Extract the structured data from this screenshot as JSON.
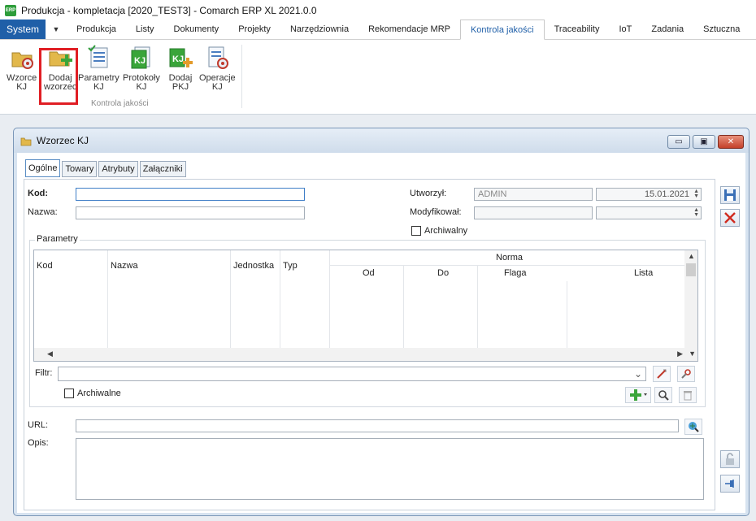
{
  "window": {
    "title": "Produkcja - kompletacja [2020_TEST3] - Comarch ERP XL 2021.0.0",
    "logo": "ERP"
  },
  "menu": {
    "system": "System",
    "tabs": [
      "Produkcja",
      "Listy",
      "Dokumenty",
      "Projekty",
      "Narzędziownia",
      "Rekomendacje MRP",
      "Kontrola jakości",
      "Traceability",
      "IoT",
      "Zadania",
      "Sztuczna"
    ],
    "active_tab": "Kontrola jakości"
  },
  "ribbon": {
    "buttons": [
      {
        "id": "wzorce",
        "line1": "Wzorce",
        "line2": "KJ"
      },
      {
        "id": "dodaj-wzorzec",
        "line1": "Dodaj",
        "line2": "wzorzec"
      },
      {
        "id": "parametry",
        "line1": "Parametry",
        "line2": "KJ"
      },
      {
        "id": "protokoly",
        "line1": "Protokoły",
        "line2": "KJ"
      },
      {
        "id": "dodaj-pkj",
        "line1": "Dodaj",
        "line2": "PKJ"
      },
      {
        "id": "operacje",
        "line1": "Operacje",
        "line2": "KJ"
      }
    ],
    "group_label": "Kontrola jakości"
  },
  "child": {
    "title": "Wzorzec KJ",
    "tabs": [
      "Ogólne",
      "Towary",
      "Atrybuty",
      "Załączniki"
    ],
    "active_tab": "Ogólne",
    "form": {
      "kod_label": "Kod:",
      "kod_value": "",
      "nazwa_label": "Nazwa:",
      "nazwa_value": "",
      "utworzyl_label": "Utworzył:",
      "utworzyl_user": "ADMIN",
      "utworzyl_date": "15.01.2021",
      "modyfikowal_label": "Modyfikował:",
      "modyfikowal_user": "",
      "modyfikowal_date": "",
      "archiwalny_label": "Archiwalny",
      "archiwalny_checked": false
    },
    "params": {
      "title": "Parametry",
      "columns": {
        "kod": "Kod",
        "nazwa": "Nazwa",
        "jednostka": "Jednostka",
        "typ": "Typ",
        "norma": "Norma",
        "od": "Od",
        "do": "Do",
        "flaga": "Flaga",
        "lista": "Lista"
      },
      "rows": [],
      "filter_label": "Filtr:",
      "filter_value": "",
      "archiwalne_label": "Archiwalne",
      "archiwalne_checked": false
    },
    "url_label": "URL:",
    "url_value": "",
    "opis_label": "Opis:",
    "opis_value": ""
  },
  "colors": {
    "accent": "#1f5fa8",
    "highlight": "#e01e24",
    "window_frame": "#d7e3f0"
  }
}
